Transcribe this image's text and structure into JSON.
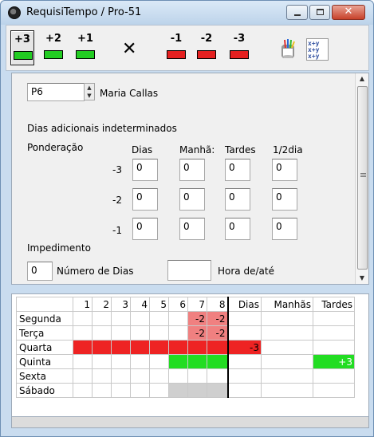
{
  "window": {
    "title": "RequisiTempo / Pro-51"
  },
  "toolbar": {
    "buttons": [
      {
        "label": "+3",
        "color": "#22cc22"
      },
      {
        "label": "+2",
        "color": "#22cc22"
      },
      {
        "label": "+1",
        "color": "#22cc22"
      },
      {
        "label": "✕",
        "color": ""
      },
      {
        "label": "-1",
        "color": "#e52020"
      },
      {
        "label": "-2",
        "color": "#e52020"
      },
      {
        "label": "-3",
        "color": "#e52020"
      }
    ],
    "icons": [
      "paint-bucket-icon",
      "variables-icon"
    ],
    "vars_glyph": "x+y x+y x+y"
  },
  "form": {
    "person_code": "P6",
    "person_name": "Maria Callas",
    "section_heading": "Dias adicionais indeterminados",
    "weighting_label": "Ponderação",
    "columns": [
      "Dias",
      "Manhã:",
      "Tardes",
      "1/2dia"
    ],
    "rows": [
      {
        "label": "-3",
        "values": [
          "0",
          "0",
          "0",
          "0"
        ]
      },
      {
        "label": "-2",
        "values": [
          "0",
          "0",
          "0",
          "0"
        ]
      },
      {
        "label": "-1",
        "values": [
          "0",
          "0",
          "0",
          "0"
        ]
      }
    ],
    "impediment_label": "Impedimento",
    "days_value": "0",
    "days_label": "Número de Dias",
    "time_value": "",
    "time_label": "Hora de/até"
  },
  "grid": {
    "columns": [
      "",
      "1",
      "2",
      "3",
      "4",
      "5",
      "6",
      "7",
      "8",
      "Dias",
      "Manhãs",
      "Tardes"
    ],
    "rows": [
      {
        "day": "Segunda",
        "cells": [
          "",
          "",
          "",
          "",
          "",
          "",
          "-2",
          "-2"
        ],
        "dias": "",
        "manhas": "",
        "tardes": ""
      },
      {
        "day": "Terça",
        "cells": [
          "",
          "",
          "",
          "",
          "",
          "",
          "-2",
          "-2"
        ],
        "dias": "",
        "manhas": "",
        "tardes": ""
      },
      {
        "day": "Quarta",
        "cells": [
          "",
          "",
          "",
          "",
          "",
          "",
          "",
          ""
        ],
        "dias": "-3",
        "manhas": "",
        "tardes": ""
      },
      {
        "day": "Quinta",
        "cells": [
          "",
          "",
          "",
          "",
          "",
          "",
          "",
          ""
        ],
        "dias": "",
        "manhas": "",
        "tardes": "+3"
      },
      {
        "day": "Sexta",
        "cells": [
          "",
          "",
          "",
          "",
          "",
          "",
          "",
          ""
        ],
        "dias": "",
        "manhas": "",
        "tardes": ""
      },
      {
        "day": "Sábado",
        "cells": [
          "",
          "",
          "",
          "",
          "",
          "",
          "",
          ""
        ],
        "dias": "",
        "manhas": "",
        "tardes": ""
      }
    ],
    "colors": {
      "red": "#ee2323",
      "pink": "#f08080",
      "green": "#22dd22",
      "gray": "#cfcfcf"
    }
  }
}
